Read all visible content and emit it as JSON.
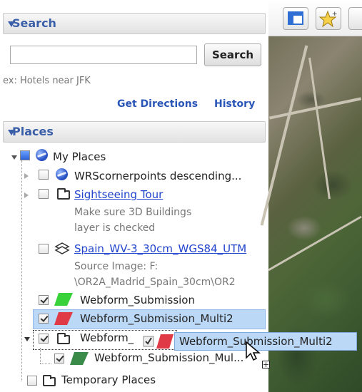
{
  "search_panel": {
    "title": "Search",
    "input_value": "",
    "button_label": "Search",
    "hint": "ex: Hotels near JFK",
    "get_directions": "Get Directions",
    "history": "History"
  },
  "places_panel": {
    "title": "Places",
    "items": [
      {
        "label": "My Places"
      },
      {
        "label": "WRScornerpoints descending..."
      },
      {
        "label": "Sightseeing Tour",
        "desc1": "Make sure 3D Buildings",
        "desc2": "layer is checked"
      },
      {
        "label": "Spain_WV-3_30cm_WGS84_UTM",
        "desc1": "Source Image: F:",
        "desc2": "\\OR2A_Madrid_Spain_30cm\\OR2"
      },
      {
        "label": "Webform_Submission"
      },
      {
        "label": "Webform_Submission_Multi2"
      },
      {
        "label": "Webform_"
      },
      {
        "label": "Webform_Submission_Mul..."
      },
      {
        "label": "Temporary Places"
      }
    ],
    "drag_tooltip": "Webform_Submission_Multi2"
  },
  "colors": {
    "header_text": "#3a5ea8",
    "link": "#2244cc",
    "selection": "#bcd8f7",
    "polygon_green": "#39d23a",
    "polygon_red": "#e03a46",
    "polygon_dark_green": "#3a8a4a"
  },
  "icons": {
    "collapse": "triangle-down-icon",
    "my_places": "globe-icon",
    "folder": "folder-icon",
    "image_overlay": "overlay-layers-icon",
    "polygon": "polygon-icon",
    "toolbar_sidebar": "sidebar-toggle-icon",
    "toolbar_placemark": "add-placemark-icon"
  }
}
